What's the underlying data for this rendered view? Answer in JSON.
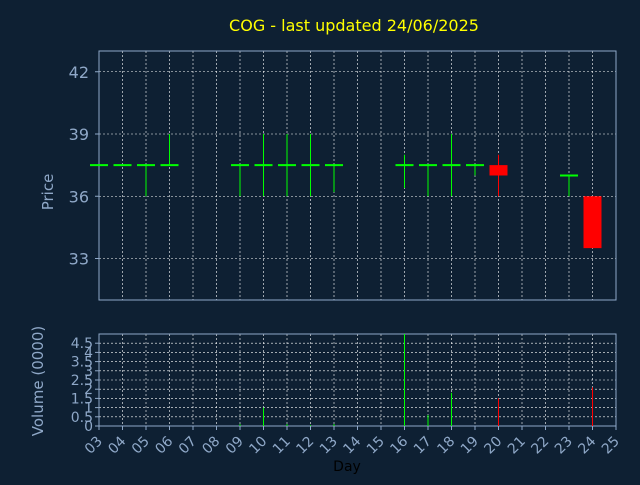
{
  "colors": {
    "background": "#0e2033",
    "title": "#ffff00",
    "axis": "#8fa8c8",
    "grid": "#ffffff",
    "up": "#00ff00",
    "down": "#ff0000"
  },
  "chart_data": [
    {
      "type": "candlestick",
      "title": "COG - last updated 24/06/2025",
      "ylabel": "Price",
      "ylim": [
        31,
        43.0
      ],
      "yticks": [
        "33",
        "36",
        "39",
        "42"
      ],
      "ytick_values": [
        33,
        36,
        39,
        42
      ],
      "grid": true,
      "days": [
        3,
        4,
        5,
        6,
        9,
        10,
        11,
        12,
        13,
        16,
        17,
        18,
        19,
        20,
        23,
        24
      ],
      "open": [
        37.5,
        37.5,
        37.5,
        37.5,
        37.5,
        37.5,
        37.5,
        37.5,
        37.5,
        37.5,
        37.5,
        37.5,
        37.5,
        37.5,
        37.0,
        36.0
      ],
      "high": [
        37.5,
        37.5,
        37.5,
        39.0,
        37.5,
        39.0,
        39.0,
        39.0,
        37.5,
        38.0,
        37.5,
        39.0,
        37.5,
        38.0,
        37.0,
        36.0
      ],
      "low": [
        37.5,
        37.5,
        36.0,
        37.5,
        36.0,
        36.0,
        36.0,
        36.0,
        36.2,
        36.4,
        36.0,
        36.0,
        37.0,
        36.0,
        36.0,
        33.5
      ],
      "close": [
        37.5,
        37.5,
        37.5,
        37.5,
        37.5,
        37.5,
        37.5,
        37.5,
        37.5,
        37.5,
        37.5,
        37.5,
        37.5,
        37.0,
        37.0,
        33.5
      ]
    },
    {
      "type": "bar",
      "ylabel": "Volume (0000)",
      "xlabel": "Day",
      "ylim": [
        0,
        5.0
      ],
      "yticks": [
        "0",
        "0.5",
        "1",
        "1.5",
        "2",
        "2.5",
        "3",
        "3.5",
        "4",
        "4.5"
      ],
      "ytick_values": [
        0,
        0.5,
        1,
        1.5,
        2,
        2.5,
        3,
        3.5,
        4,
        4.5
      ],
      "xticks": [
        "03",
        "04",
        "05",
        "06",
        "07",
        "08",
        "09",
        "10",
        "11",
        "12",
        "13",
        "14",
        "15",
        "16",
        "17",
        "18",
        "19",
        "20",
        "21",
        "22",
        "23",
        "24",
        "25"
      ],
      "xtick_values": [
        3,
        4,
        5,
        6,
        7,
        8,
        9,
        10,
        11,
        12,
        13,
        14,
        15,
        16,
        17,
        18,
        19,
        20,
        21,
        22,
        23,
        24,
        25
      ],
      "days": [
        3,
        4,
        5,
        6,
        9,
        10,
        11,
        12,
        13,
        16,
        17,
        18,
        19,
        20,
        23,
        24
      ],
      "values": [
        0,
        0,
        0,
        0,
        0.1,
        1.0,
        0.1,
        0.05,
        0.1,
        5.0,
        0.6,
        1.8,
        0,
        1.5,
        0,
        2.1
      ],
      "direction": [
        "up",
        "up",
        "up",
        "up",
        "up",
        "up",
        "up",
        "up",
        "up",
        "up",
        "up",
        "up",
        "up",
        "down",
        "up",
        "down"
      ]
    }
  ]
}
